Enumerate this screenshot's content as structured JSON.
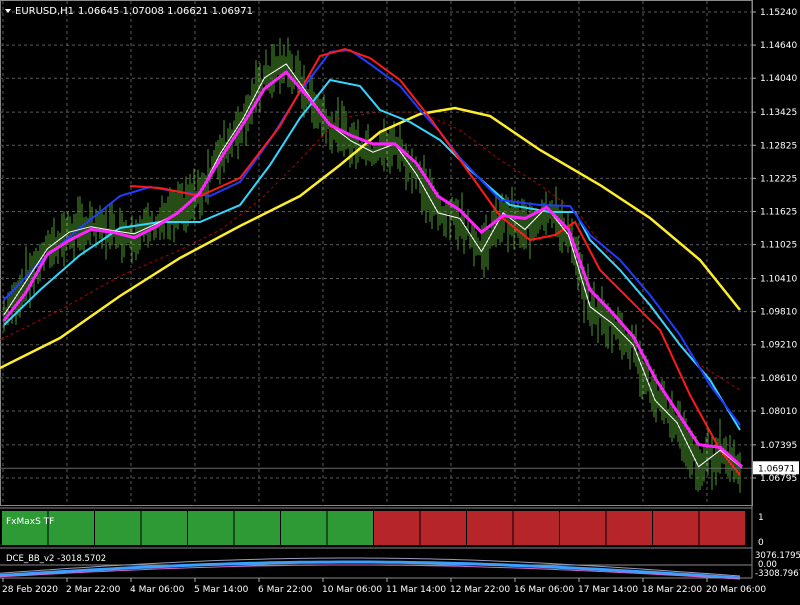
{
  "header": {
    "symbol_tf": "EURUSD,H1",
    "ohlc": "1.06645 1.07008 1.06621 1.06971"
  },
  "price_axis": {
    "labels": [
      "1.15240",
      "1.14640",
      "1.14040",
      "1.13425",
      "1.12825",
      "1.12225",
      "1.11625",
      "1.11025",
      "1.10410",
      "1.09810",
      "1.09210",
      "1.08610",
      "1.08010",
      "1.07395",
      "1.06795"
    ],
    "values": [
      1.1524,
      1.1464,
      1.1404,
      1.13425,
      1.12825,
      1.12225,
      1.11625,
      1.11025,
      1.1041,
      1.0981,
      1.0921,
      1.0861,
      1.0801,
      1.07395,
      1.06795
    ],
    "current_price": "1.06971",
    "current_value": 1.06971
  },
  "time_axis": {
    "labels": [
      "28 Feb 2020",
      "2 Mar 22:00",
      "4 Mar 06:00",
      "5 Mar 14:00",
      "6 Mar 22:00",
      "10 Mar 06:00",
      "11 Mar 14:00",
      "12 Mar 22:00",
      "16 Mar 06:00",
      "17 Mar 14:00",
      "18 Mar 22:00",
      "20 Mar 06:00"
    ]
  },
  "colors": {
    "background": "#000000",
    "grid": "#5a5a5a",
    "axis_text": "#ffffff",
    "bars": "#4e9a2e",
    "ma_white": "#ffffff",
    "ma_magenta": "#ff22ff",
    "ma_red": "#ff1a1a",
    "ma_blue": "#1f3cff",
    "ma_cyan": "#33d6ff",
    "ma_yellow": "#ffee2a",
    "ma_darkred_dashed": "#b00000",
    "tf_up": "#2d9a36",
    "tf_down": "#b5252a"
  },
  "indicator_fxmaxs": {
    "title": "FxMaxS TF",
    "scale_top": "1",
    "scale_bottom": "0",
    "blocks": [
      "up",
      "up",
      "up",
      "up",
      "up",
      "up",
      "up",
      "up",
      "down",
      "down",
      "down",
      "down",
      "down",
      "down",
      "down",
      "down"
    ]
  },
  "indicator_dce": {
    "title": "DCE_BB_v2 -3018.5702",
    "scale_top": "3076.1795",
    "scale_mid": "0.00",
    "scale_bottom": "-3308.7967"
  },
  "chart_data": {
    "type": "line",
    "title": "EURUSD,H1",
    "ylim": [
      1.0645,
      1.1545
    ],
    "series": [
      {
        "name": "",
        "color": "white",
        "values": [
          1.0975,
          1.1035,
          1.1095,
          1.1125,
          1.1135,
          1.1128,
          1.1122,
          1.114,
          1.116,
          1.1195,
          1.127,
          1.133,
          1.1405,
          1.143,
          1.1375,
          1.132,
          1.129,
          1.127,
          1.1285,
          1.123,
          1.116,
          1.115,
          1.109,
          1.116,
          1.113,
          1.117,
          1.112,
          1.099,
          1.096,
          1.092,
          1.082,
          1.078,
          1.07,
          1.073,
          1.0697
        ]
      },
      {
        "name": "",
        "color": "magenta",
        "values": [
          1.0965,
          1.1015,
          1.1085,
          1.111,
          1.113,
          1.1125,
          1.1115,
          1.1135,
          1.116,
          1.1195,
          1.126,
          1.132,
          1.1385,
          1.1415,
          1.137,
          1.132,
          1.13,
          1.1285,
          1.1285,
          1.125,
          1.119,
          1.1165,
          1.1125,
          1.1155,
          1.115,
          1.117,
          1.113,
          1.102,
          1.098,
          1.0935,
          1.086,
          1.08,
          1.074,
          1.0735,
          1.07
        ]
      }
    ]
  }
}
